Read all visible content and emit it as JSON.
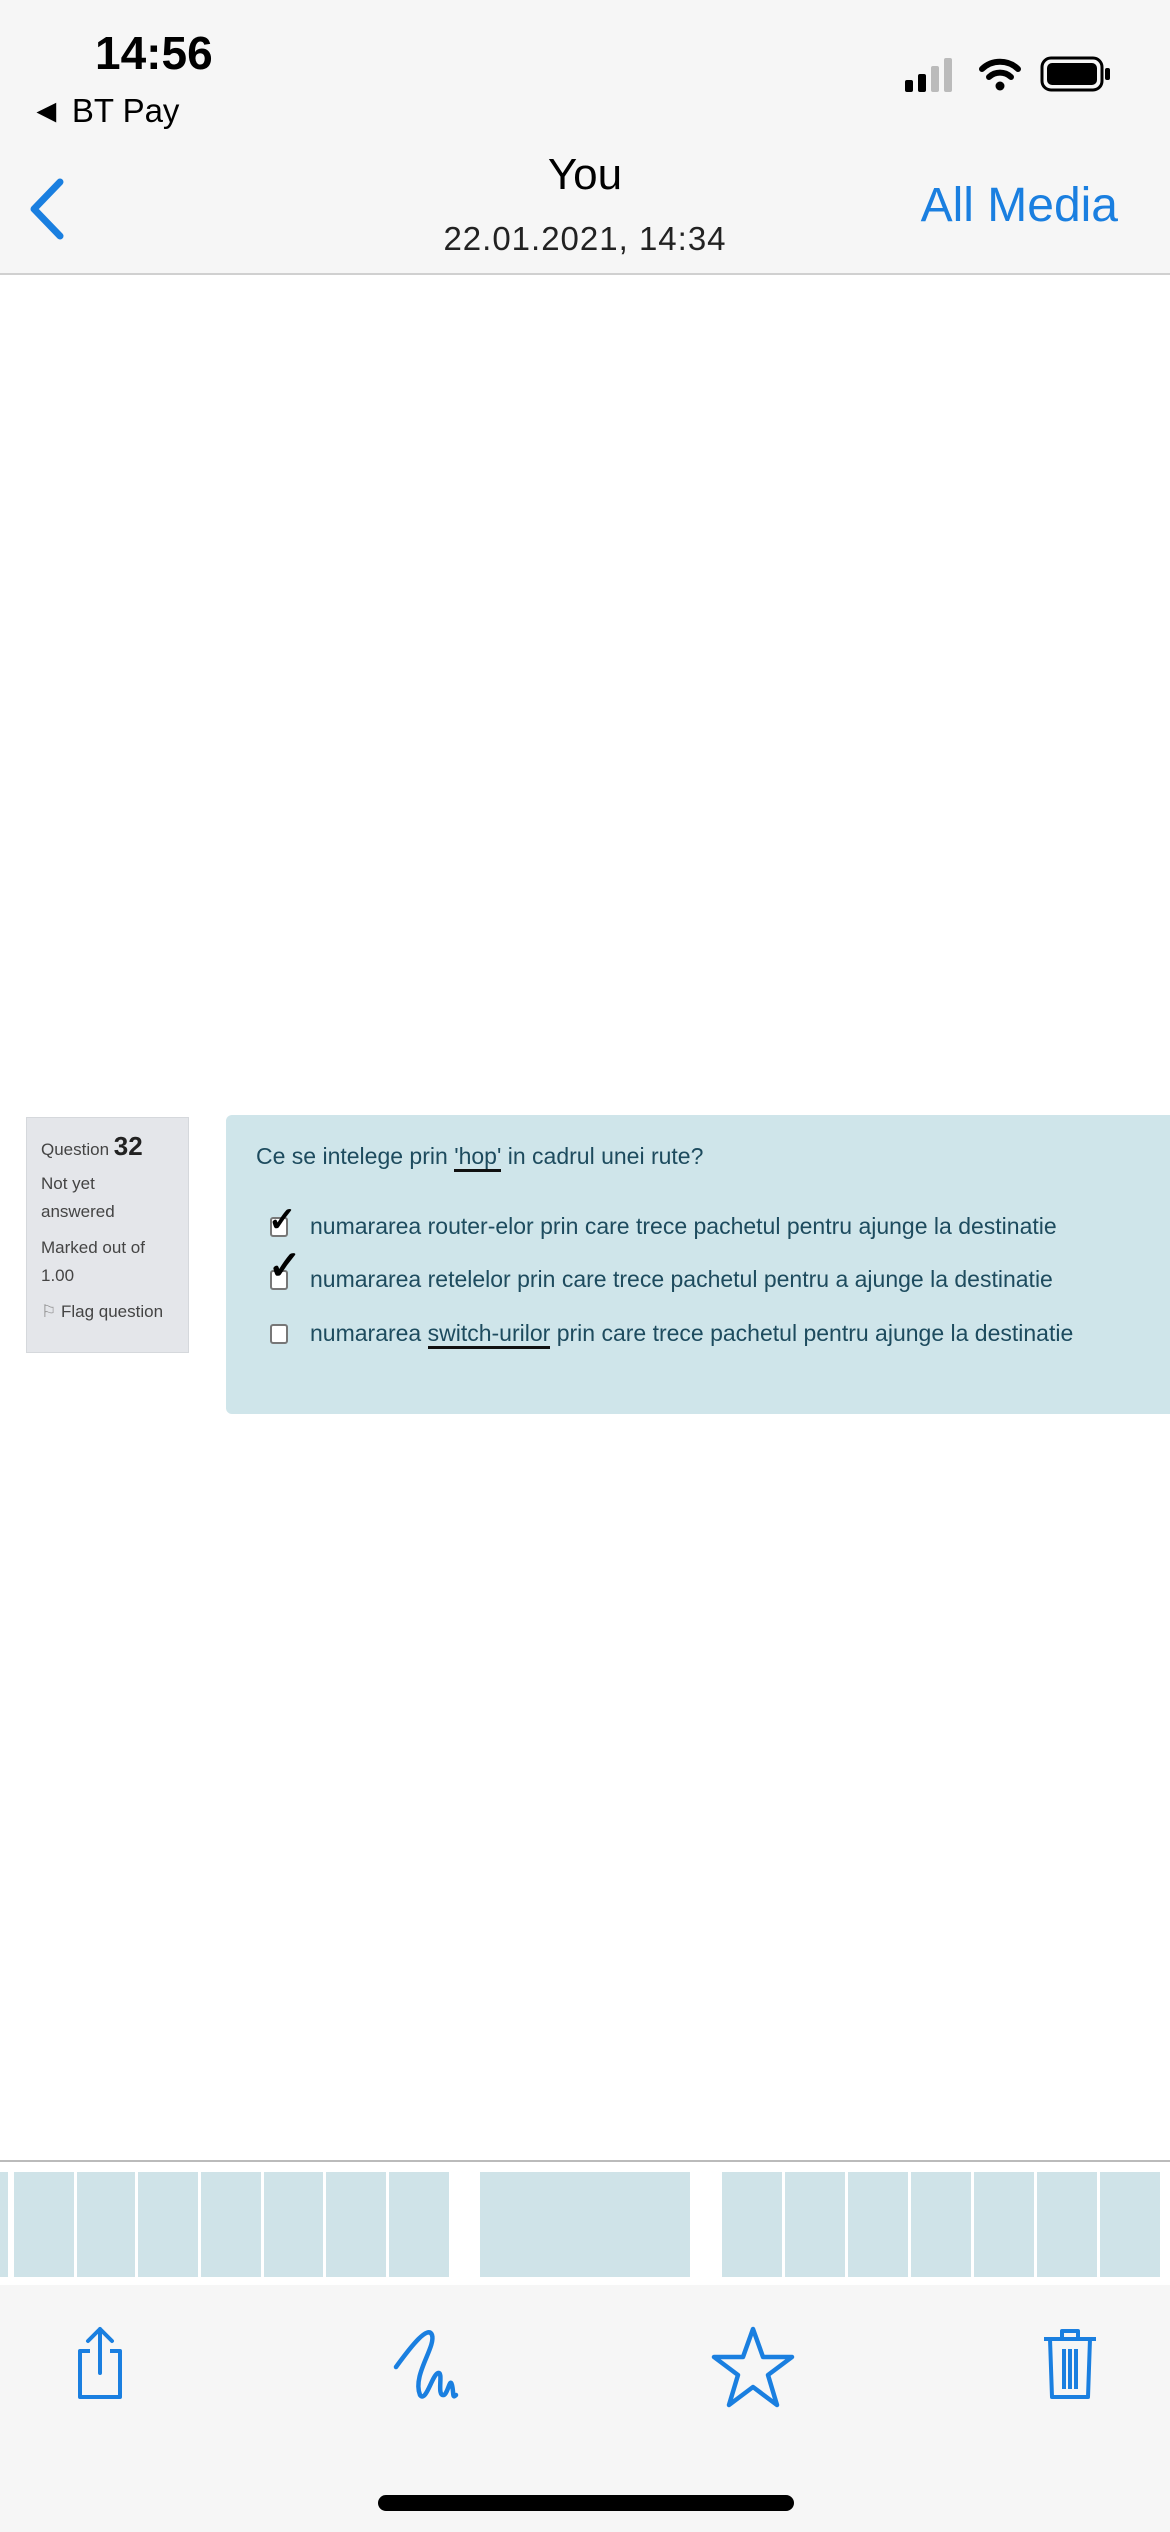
{
  "status_bar": {
    "time": "14:56",
    "back_app": "◄ BT Pay"
  },
  "nav": {
    "title": "You",
    "subtitle": "22.01.2021, 14:34",
    "all_media": "All Media"
  },
  "question": {
    "label": "Question",
    "number": "32",
    "state_line1": "Not yet",
    "state_line2": "answered",
    "mark_line1": "Marked out of",
    "mark_line2": "1.00",
    "flag": "Flag question",
    "text_before": "Ce se intelege prin ",
    "text_hop": "'hop'",
    "text_after": " in cadrul unei rute?",
    "options": [
      {
        "text": "numararea router-elor prin care trece pachetul pentru ajunge la destinatie",
        "handwritten_check": true
      },
      {
        "text": "numararea retelelor prin care trece pachetul pentru a ajunge la destinatie",
        "handwritten_check": true
      },
      {
        "pre": "numararea ",
        "underlined": "switch-urilor",
        "post": " prin care trece pachetul pentru ajunge la destinatie",
        "handwritten_check": false
      }
    ]
  },
  "toolbar": {
    "icons": [
      "share-icon",
      "markup-icon",
      "favorite-star-icon",
      "trash-icon"
    ]
  },
  "colors": {
    "accent": "#1a7fe0",
    "panel": "#cfe5ea"
  }
}
